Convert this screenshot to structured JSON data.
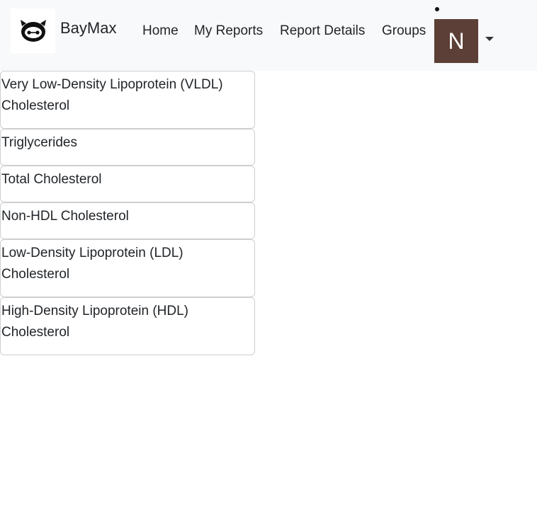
{
  "navbar": {
    "brand": "BayMax",
    "links": [
      {
        "label": "Home"
      },
      {
        "label": "My Reports"
      },
      {
        "label": "Report Details"
      },
      {
        "label": "Groups"
      }
    ],
    "avatar_initial": "N",
    "avatar_color": "#5c3f36",
    "background": "#f8f9fa"
  },
  "tests": [
    {
      "label": "Very Low-Density Lipoprotein (VLDL) Cholesterol"
    },
    {
      "label": "Triglycerides"
    },
    {
      "label": "Total Cholesterol"
    },
    {
      "label": "Non-HDL Cholesterol"
    },
    {
      "label": "Low-Density Lipoprotein (LDL) Cholesterol"
    },
    {
      "label": "High-Density Lipoprotein (HDL) Cholesterol"
    }
  ]
}
